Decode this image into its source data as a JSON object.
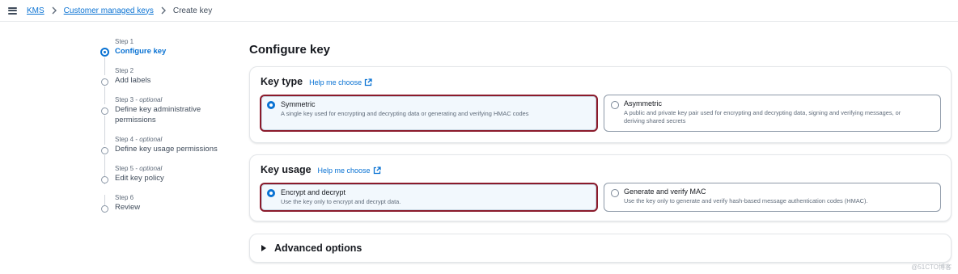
{
  "breadcrumb": {
    "items": [
      "KMS",
      "Customer managed keys"
    ],
    "current": "Create key"
  },
  "steps": [
    {
      "number": "Step 1",
      "optional": "",
      "title": "Configure key"
    },
    {
      "number": "Step 2",
      "optional": "",
      "title": "Add labels"
    },
    {
      "number": "Step 3 - ",
      "optional": "optional",
      "title_line1": "Define key administrative",
      "title_line2": "permissions"
    },
    {
      "number": "Step 4 - ",
      "optional": "optional",
      "title": "Define key usage permissions"
    },
    {
      "number": "Step 5 - ",
      "optional": "optional",
      "title": "Edit key policy"
    },
    {
      "number": "Step 6",
      "optional": "",
      "title": "Review"
    }
  ],
  "page_title": "Configure key",
  "key_type": {
    "title": "Key type",
    "help": "Help me choose",
    "options": [
      {
        "label": "Symmetric",
        "desc": "A single key used for encrypting and decrypting data or generating and verifying HMAC codes",
        "selected": true
      },
      {
        "label": "Asymmetric",
        "desc_line1": "A public and private key pair used for encrypting and decrypting data, signing and verifying messages, or",
        "desc_line2": "deriving shared secrets",
        "selected": false
      }
    ]
  },
  "key_usage": {
    "title": "Key usage",
    "help": "Help me choose",
    "options": [
      {
        "label": "Encrypt and decrypt",
        "desc": "Use the key only to encrypt and decrypt data.",
        "selected": true
      },
      {
        "label": "Generate and verify MAC",
        "desc": "Use the key only to generate and verify hash-based message authentication codes (HMAC).",
        "selected": false
      }
    ]
  },
  "advanced": {
    "label": "Advanced options"
  },
  "watermark": "@51CTO博客",
  "colors": {
    "accent": "#0972d3",
    "selected_border": "#8b1a2b",
    "selected_bg": "#f2f8fd"
  }
}
